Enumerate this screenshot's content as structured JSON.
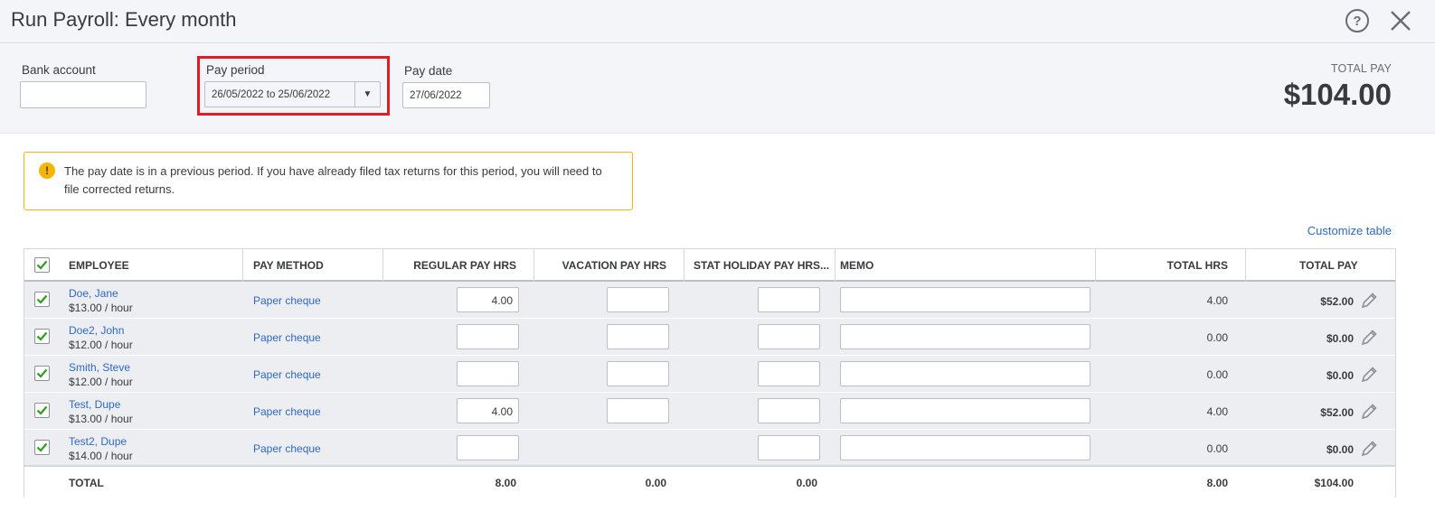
{
  "window": {
    "title": "Run Payroll: Every month"
  },
  "header": {
    "bank_account_label": "Bank account",
    "bank_account_value": "",
    "pay_period_label": "Pay period",
    "pay_period_value": "26/05/2022 to 25/06/2022",
    "pay_date_label": "Pay date",
    "pay_date_value": "27/06/2022",
    "total_pay_label": "TOTAL PAY",
    "total_pay_value": "$104.00"
  },
  "warning": {
    "icon": "!",
    "text": "The pay date is in a previous period. If you have already filed tax returns for this period, you will need to file corrected returns."
  },
  "customize_label": "Customize table",
  "table": {
    "columns": {
      "employee": "EMPLOYEE",
      "pay_method": "PAY METHOD",
      "regular": "REGULAR PAY HRS",
      "vacation": "VACATION PAY HRS",
      "stat": "STAT HOLIDAY PAY HRS...",
      "memo": "MEMO",
      "total_hrs": "TOTAL HRS",
      "total_pay": "TOTAL PAY"
    },
    "rows": [
      {
        "name": "Doe, Jane",
        "rate": "$13.00 / hour",
        "method": "Paper cheque",
        "regular": "4.00",
        "vacation": "",
        "stat": "",
        "memo": "",
        "total_hrs": "4.00",
        "total_pay": "$52.00"
      },
      {
        "name": "Doe2, John",
        "rate": "$12.00 / hour",
        "method": "Paper cheque",
        "regular": "",
        "vacation": "",
        "stat": "",
        "memo": "",
        "total_hrs": "0.00",
        "total_pay": "$0.00"
      },
      {
        "name": "Smith, Steve",
        "rate": "$12.00 / hour",
        "method": "Paper cheque",
        "regular": "",
        "vacation": "",
        "stat": "",
        "memo": "",
        "total_hrs": "0.00",
        "total_pay": "$0.00"
      },
      {
        "name": "Test, Dupe",
        "rate": "$13.00 / hour",
        "method": "Paper cheque",
        "regular": "4.00",
        "vacation": "",
        "stat": "",
        "memo": "",
        "total_hrs": "4.00",
        "total_pay": "$52.00"
      },
      {
        "name": "Test2, Dupe",
        "rate": "$14.00 / hour",
        "method": "Paper cheque",
        "regular": "",
        "vacation": null,
        "stat": "",
        "memo": "",
        "total_hrs": "0.00",
        "total_pay": "$0.00"
      }
    ],
    "totals": {
      "label": "TOTAL",
      "regular": "8.00",
      "vacation": "0.00",
      "stat": "0.00",
      "total_hrs": "8.00",
      "total_pay": "$104.00"
    }
  },
  "colors": {
    "accent_link": "#2e68c4",
    "check_green": "#2ca01c",
    "highlight_red": "#e21c22",
    "warning_border": "#f2b211"
  }
}
